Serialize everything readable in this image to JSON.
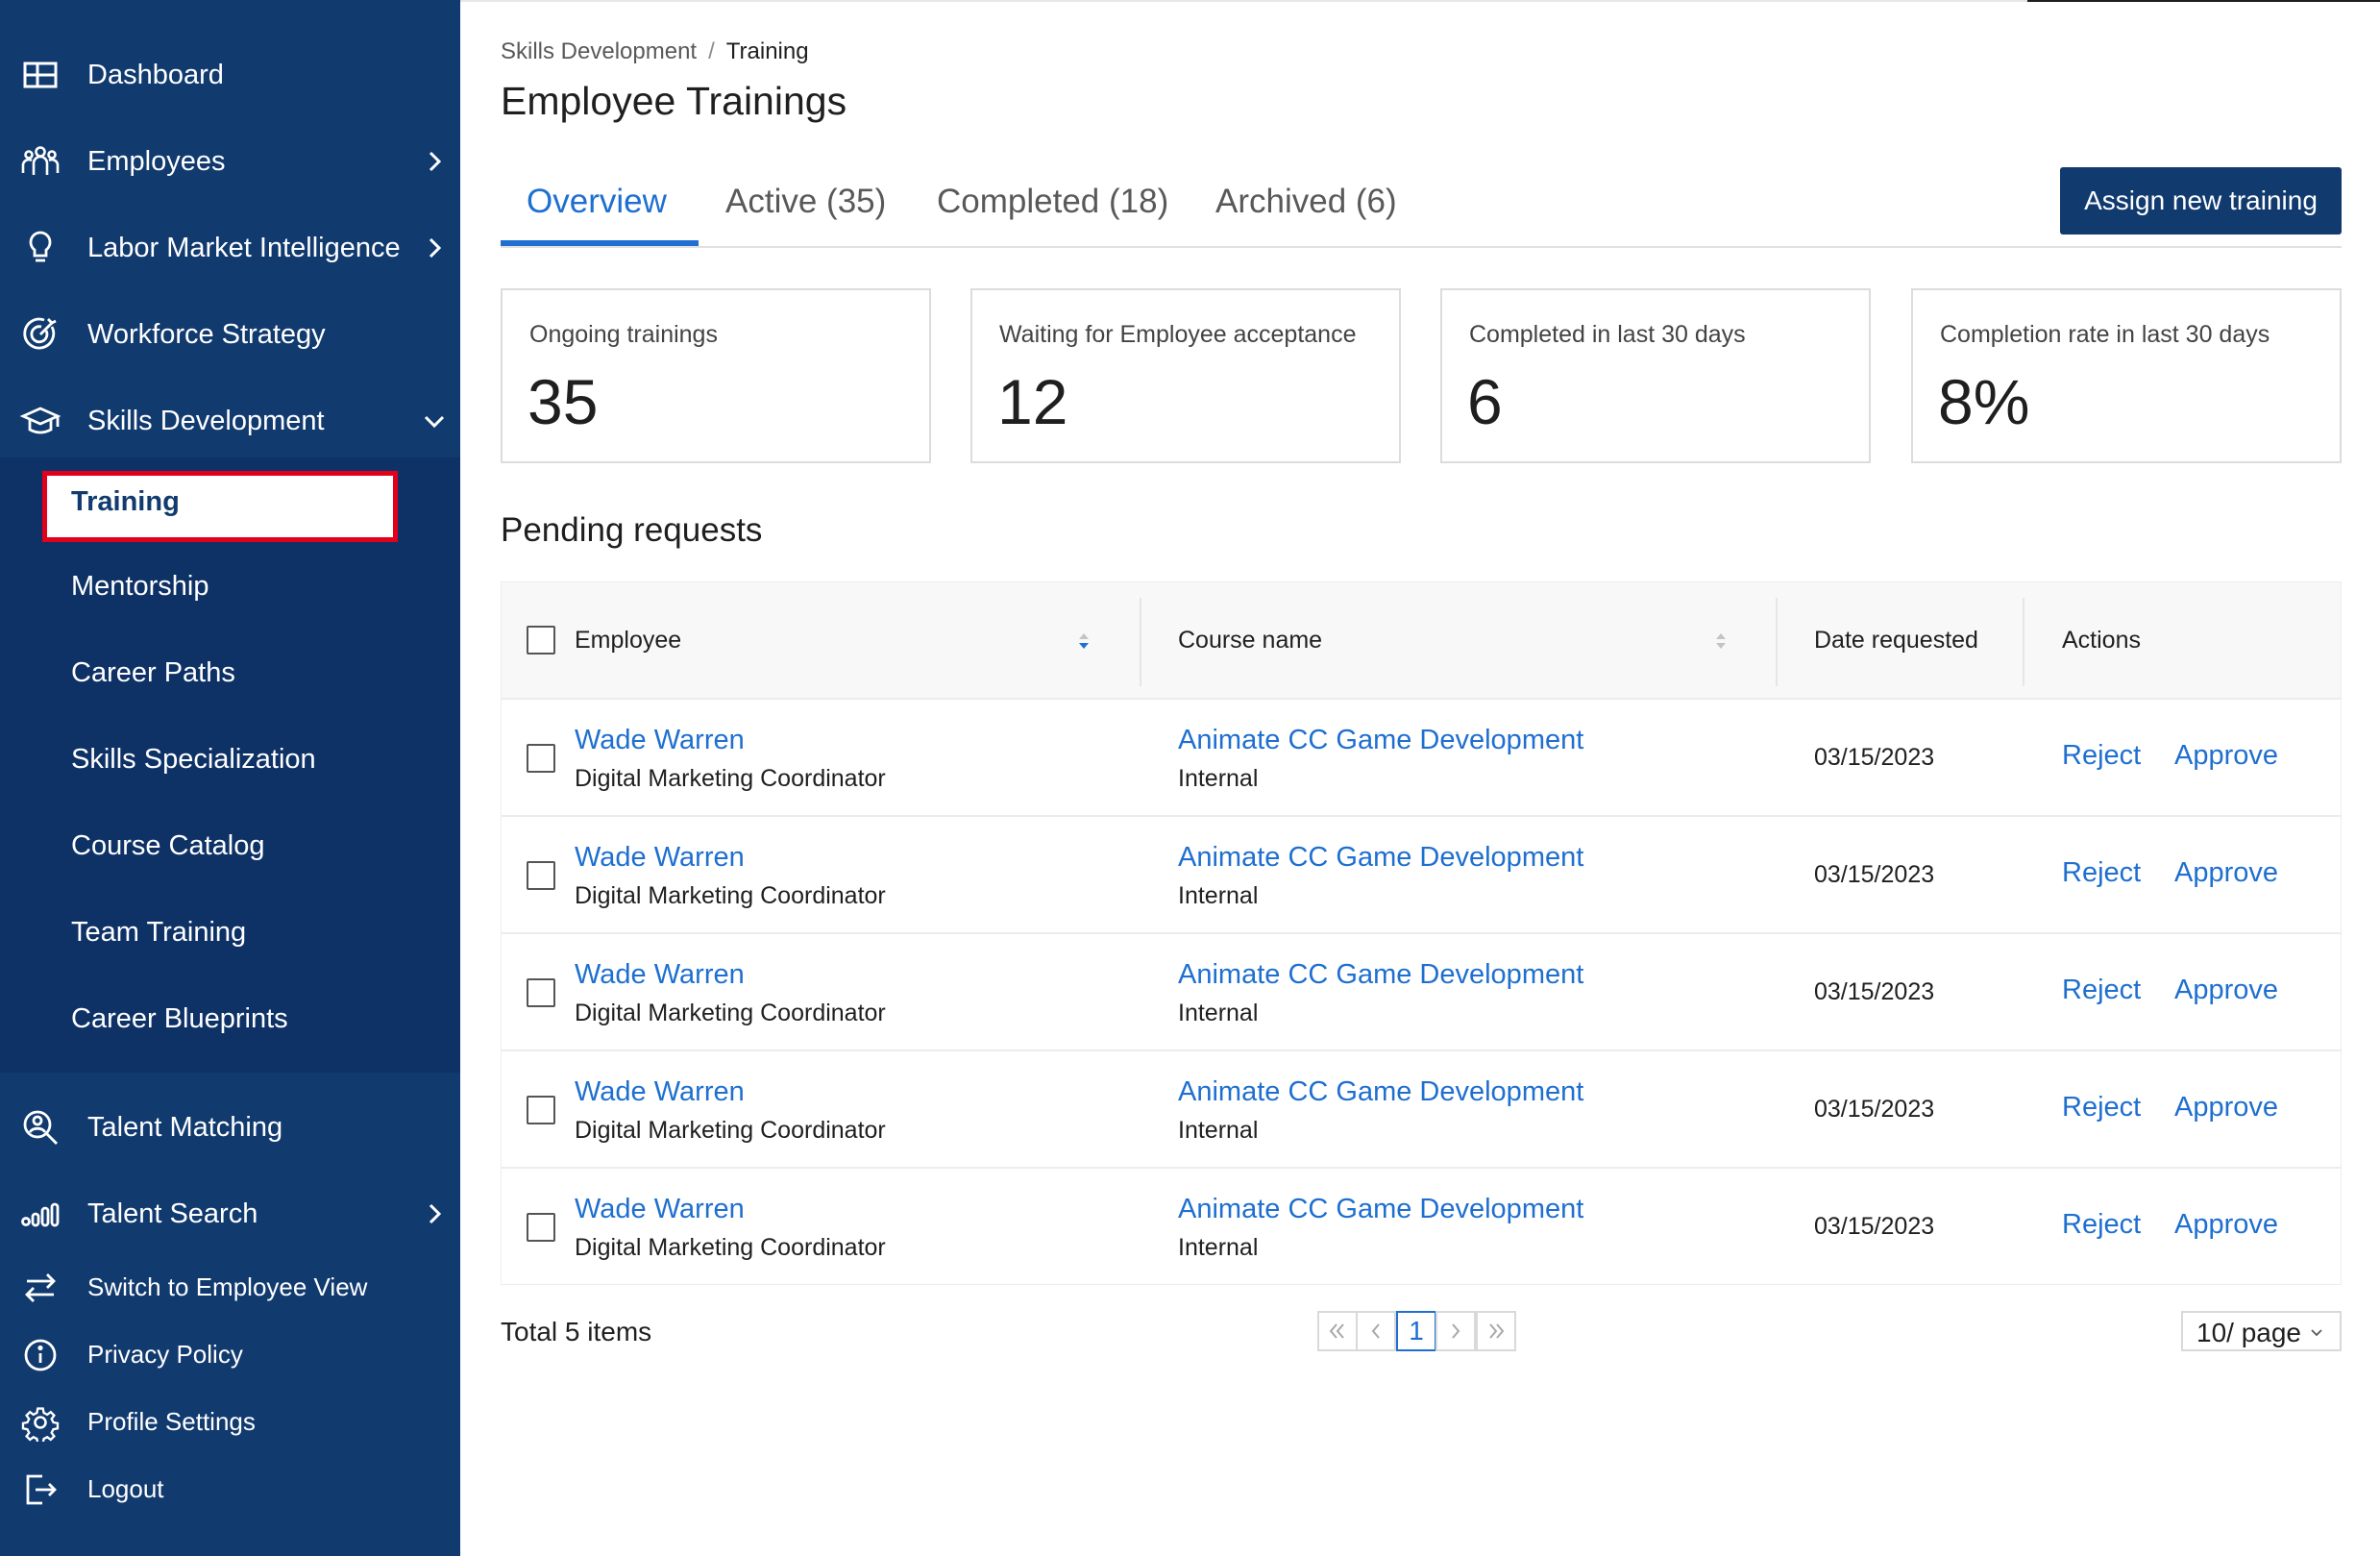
{
  "sidebar": {
    "items": [
      {
        "label": "Dashboard",
        "icon": "dashboard-grid-icon"
      },
      {
        "label": "Employees",
        "icon": "people-icon"
      },
      {
        "label": "Labor Market Intelligence",
        "icon": "lightbulb-icon"
      },
      {
        "label": "Workforce Strategy",
        "icon": "target-icon"
      },
      {
        "label": "Skills Development",
        "icon": "graduation-cap-icon"
      }
    ],
    "sub_items": [
      "Training",
      "Mentorship",
      "Career Paths",
      "Skills Specialization",
      "Course Catalog",
      "Team Training",
      "Career Blueprints"
    ],
    "lower_items": [
      {
        "label": "Talent Matching",
        "icon": "person-search-icon"
      },
      {
        "label": "Talent Search",
        "icon": "org-chart-icon"
      }
    ],
    "bottom_items": [
      {
        "label": "Switch to Employee View",
        "icon": "swap-arrows-icon"
      },
      {
        "label": "Privacy Policy",
        "icon": "info-icon"
      },
      {
        "label": "Profile Settings",
        "icon": "gear-icon"
      },
      {
        "label": "Logout",
        "icon": "logout-icon"
      }
    ]
  },
  "breadcrumb": {
    "parent": "Skills Development",
    "separator": "/",
    "current": "Training"
  },
  "page": {
    "title": "Employee Trainings"
  },
  "tabs": [
    {
      "label": "Overview"
    },
    {
      "label": "Active (35)"
    },
    {
      "label": "Completed (18)"
    },
    {
      "label": "Archived (6)"
    }
  ],
  "actions": {
    "assign_label": "Assign new training"
  },
  "stats": [
    {
      "label": "Ongoing trainings",
      "value": "35"
    },
    {
      "label": "Waiting for Employee acceptance",
      "value": "12"
    },
    {
      "label": "Completed in last 30 days",
      "value": "6"
    },
    {
      "label": "Completion rate in last 30 days",
      "value": "8%"
    }
  ],
  "pending": {
    "title": "Pending requests",
    "columns": {
      "employee": "Employee",
      "course": "Course name",
      "date": "Date requested",
      "actions": "Actions"
    },
    "rows": [
      {
        "name": "Wade Warren",
        "role": "Digital Marketing Coordinator",
        "course": "Animate CC Game Development",
        "type": "Internal",
        "date": "03/15/2023",
        "reject": "Reject",
        "approve": "Approve"
      },
      {
        "name": "Wade Warren",
        "role": "Digital Marketing Coordinator",
        "course": "Animate CC Game Development",
        "type": "Internal",
        "date": "03/15/2023",
        "reject": "Reject",
        "approve": "Approve"
      },
      {
        "name": "Wade Warren",
        "role": "Digital Marketing Coordinator",
        "course": "Animate CC Game Development",
        "type": "Internal",
        "date": "03/15/2023",
        "reject": "Reject",
        "approve": "Approve"
      },
      {
        "name": "Wade Warren",
        "role": "Digital Marketing Coordinator",
        "course": "Animate CC Game Development",
        "type": "Internal",
        "date": "03/15/2023",
        "reject": "Reject",
        "approve": "Approve"
      },
      {
        "name": "Wade Warren",
        "role": "Digital Marketing Coordinator",
        "course": "Animate CC Game Development",
        "type": "Internal",
        "date": "03/15/2023",
        "reject": "Reject",
        "approve": "Approve"
      }
    ]
  },
  "pagination": {
    "total": "Total 5 items",
    "current_page": "1",
    "page_size": "10/ page"
  },
  "colors": {
    "sidebar": "#113a6f",
    "accent": "#1e6fd0",
    "highlight": "#e3001b"
  }
}
